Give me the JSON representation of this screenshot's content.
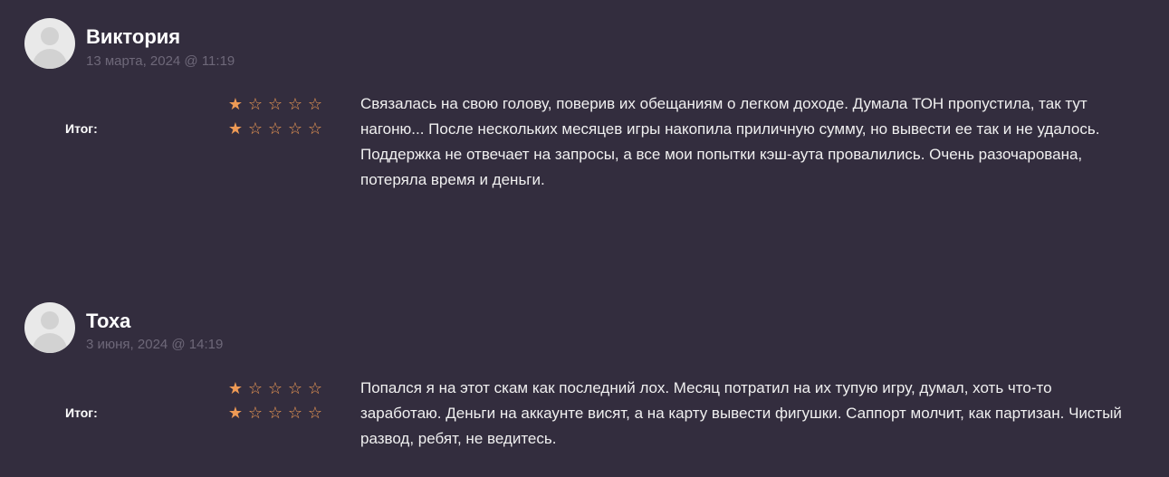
{
  "reviews": [
    {
      "author": "Виктория",
      "date": "13 марта, 2024 @ 11:19",
      "total_label": "Итог:",
      "rating_rows": [
        [
          "★",
          "☆",
          "☆",
          "☆",
          "☆"
        ],
        [
          "★",
          "☆",
          "☆",
          "☆",
          "☆"
        ]
      ],
      "text": "Связалась на свою голову, поверив их обещаниям о легком доходе. Думала ТОН пропустила, так тут нагоню... После нескольких месяцев игры накопила приличную сумму, но вывести ее так и не удалось. Поддержка не отвечает на запросы, а все мои попытки кэш-аута провалились. Очень разочарована, потеряла время и деньги."
    },
    {
      "author": "Тоха",
      "date": "3 июня, 2024 @ 14:19",
      "total_label": "Итог:",
      "rating_rows": [
        [
          "★",
          "☆",
          "☆",
          "☆",
          "☆"
        ],
        [
          "★",
          "☆",
          "☆",
          "☆",
          "☆"
        ]
      ],
      "text": "Попался я на этот скам как последний лох. Месяц потратил на их тупую игру, думал, хоть что-то заработаю. Деньги на аккаунте висят, а на карту вывести фигушки. Саппорт молчит, как партизан. Чистый развод, ребят, не ведитесь."
    }
  ],
  "colors": {
    "background": "#332d3e",
    "star": "#ee9a55",
    "date": "#6e6879"
  },
  "icons": {
    "avatar": "user-avatar-icon",
    "star_filled": "star-filled-icon",
    "star_empty": "star-empty-icon"
  }
}
